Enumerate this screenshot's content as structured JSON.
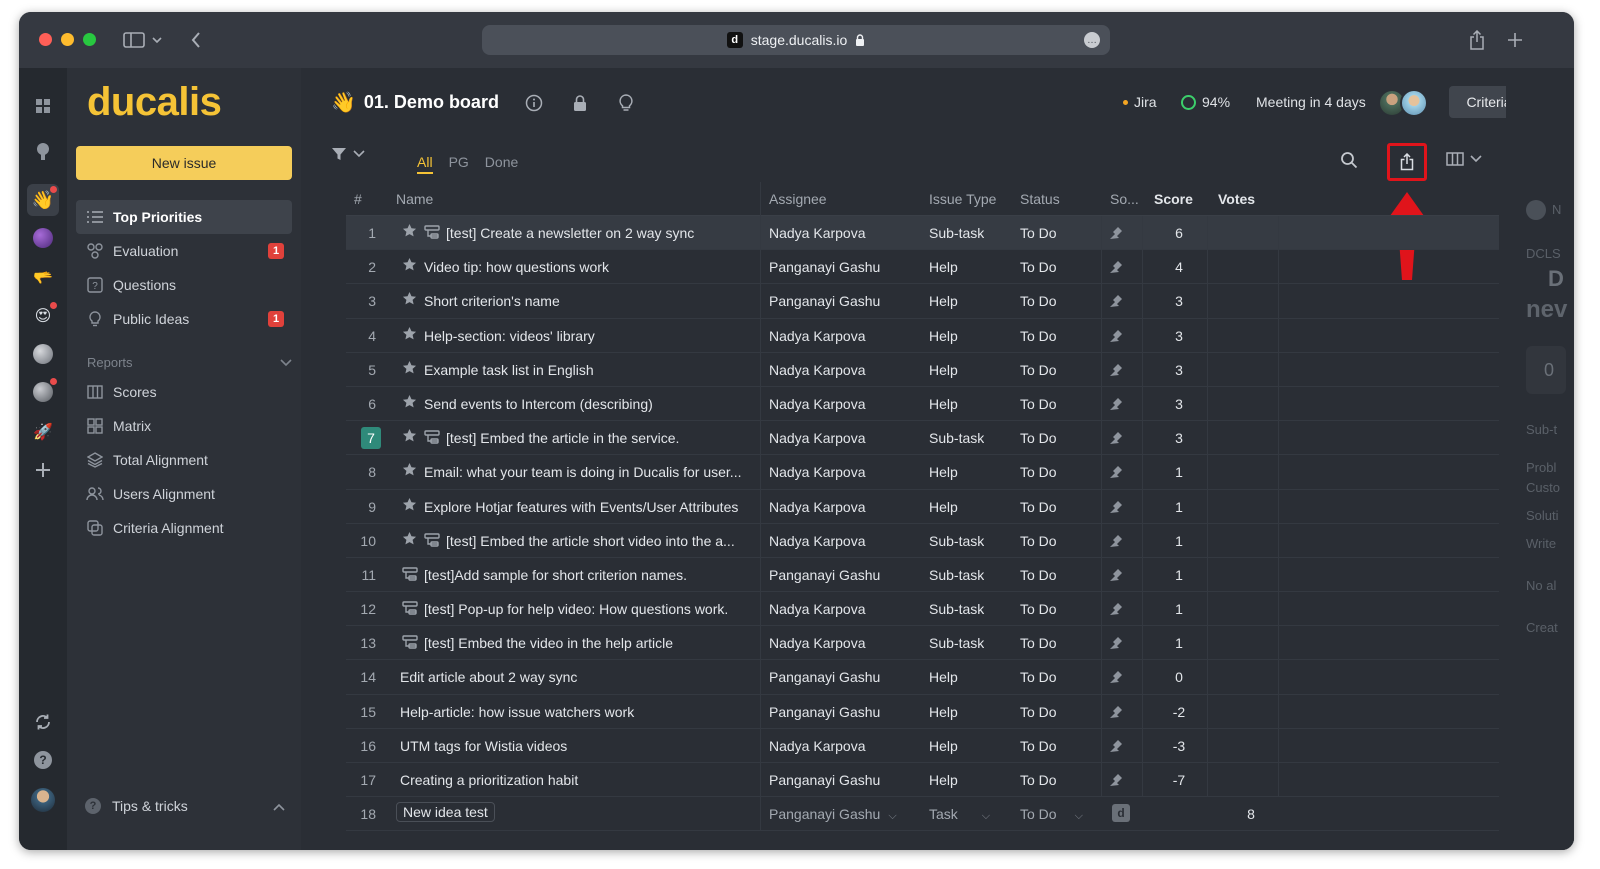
{
  "browser": {
    "url": "stage.ducalis.io",
    "favicon_letter": "d",
    "more_label": "…"
  },
  "sidebar": {
    "logo": "ducalis",
    "new_issue_label": "New issue",
    "items": [
      {
        "label": "Top Priorities",
        "icon": "list-icon",
        "active": true
      },
      {
        "label": "Evaluation",
        "icon": "nodes-icon",
        "badge": "1"
      },
      {
        "label": "Questions",
        "icon": "question-box-icon"
      },
      {
        "label": "Public Ideas",
        "icon": "lightbulb-icon",
        "badge": "1"
      }
    ],
    "reports_label": "Reports",
    "reports": [
      {
        "label": "Scores",
        "icon": "columns-icon"
      },
      {
        "label": "Matrix",
        "icon": "grid-icon"
      },
      {
        "label": "Total Alignment",
        "icon": "layers-icon"
      },
      {
        "label": "Users Alignment",
        "icon": "users-icon"
      },
      {
        "label": "Criteria Alignment",
        "icon": "overlap-icon"
      }
    ],
    "tips_label": "Tips & tricks"
  },
  "header": {
    "emoji": "👋",
    "board_title": "01. Demo board",
    "jira_label": "Jira",
    "progress": "94%",
    "meeting": "Meeting in 4 days",
    "criteria_label": "Criteria"
  },
  "tabs": [
    "All",
    "PG",
    "Done"
  ],
  "table": {
    "columns": {
      "num": "#",
      "name": "Name",
      "assignee": "Assignee",
      "type": "Issue Type",
      "status": "Status",
      "so": "So...",
      "score": "Score",
      "votes": "Votes"
    },
    "rows": [
      {
        "n": "1",
        "star": true,
        "sub": true,
        "name": "[test] Create a newsletter on 2 way sync",
        "assignee": "Nadya Karpova",
        "type": "Sub-task",
        "status": "To Do",
        "score": "6"
      },
      {
        "n": "2",
        "star": true,
        "sub": false,
        "name": "Video tip: how questions work",
        "assignee": "Panganayi Gashu",
        "type": "Help",
        "status": "To Do",
        "score": "4"
      },
      {
        "n": "3",
        "star": true,
        "sub": false,
        "name": "Short criterion's name",
        "assignee": "Panganayi Gashu",
        "type": "Help",
        "status": "To Do",
        "score": "3"
      },
      {
        "n": "4",
        "star": true,
        "sub": false,
        "name": "Help-section: videos' library",
        "assignee": "Nadya Karpova",
        "type": "Help",
        "status": "To Do",
        "score": "3"
      },
      {
        "n": "5",
        "star": true,
        "sub": false,
        "name": "Example task list in English",
        "assignee": "Nadya Karpova",
        "type": "Help",
        "status": "To Do",
        "score": "3"
      },
      {
        "n": "6",
        "star": true,
        "sub": false,
        "name": "Send events to Intercom (describing)",
        "assignee": "Nadya Karpova",
        "type": "Help",
        "status": "To Do",
        "score": "3"
      },
      {
        "n": "7",
        "star": true,
        "sub": true,
        "name": "[test] Embed the article in the service.",
        "assignee": "Nadya Karpova",
        "type": "Sub-task",
        "status": "To Do",
        "score": "3"
      },
      {
        "n": "8",
        "star": true,
        "sub": false,
        "name": "Email: what your team is doing in Ducalis for user...",
        "assignee": "Nadya Karpova",
        "type": "Help",
        "status": "To Do",
        "score": "1"
      },
      {
        "n": "9",
        "star": true,
        "sub": false,
        "name": "Explore Hotjar features with Events/User Attributes",
        "assignee": "Nadya Karpova",
        "type": "Help",
        "status": "To Do",
        "score": "1"
      },
      {
        "n": "10",
        "star": true,
        "sub": true,
        "name": "[test] Embed the article short video into the a...",
        "assignee": "Nadya Karpova",
        "type": "Sub-task",
        "status": "To Do",
        "score": "1"
      },
      {
        "n": "11",
        "star": false,
        "sub": true,
        "name": "[test]Add sample for short criterion names.",
        "assignee": "Panganayi Gashu",
        "type": "Sub-task",
        "status": "To Do",
        "score": "1"
      },
      {
        "n": "12",
        "star": false,
        "sub": true,
        "name": "[test] Pop-up for help video: How questions work.",
        "assignee": "Nadya Karpova",
        "type": "Sub-task",
        "status": "To Do",
        "score": "1"
      },
      {
        "n": "13",
        "star": false,
        "sub": true,
        "name": "[test] Embed the video in the help article",
        "assignee": "Nadya Karpova",
        "type": "Sub-task",
        "status": "To Do",
        "score": "1"
      },
      {
        "n": "14",
        "star": false,
        "sub": false,
        "name": "Edit article about 2 way sync",
        "assignee": "Panganayi Gashu",
        "type": "Help",
        "status": "To Do",
        "score": "0"
      },
      {
        "n": "15",
        "star": false,
        "sub": false,
        "name": "Help-article: how issue watchers work",
        "assignee": "Panganayi Gashu",
        "type": "Help",
        "status": "To Do",
        "score": "-2"
      },
      {
        "n": "16",
        "star": false,
        "sub": false,
        "name": "UTM tags for Wistia videos",
        "assignee": "Nadya Karpova",
        "type": "Help",
        "status": "To Do",
        "score": "-3"
      },
      {
        "n": "17",
        "star": false,
        "sub": false,
        "name": "Creating a prioritization habit",
        "assignee": "Panganayi Gashu",
        "type": "Help",
        "status": "To Do",
        "score": "-7"
      }
    ],
    "new_row": {
      "n": "18",
      "name": "New idea test",
      "assignee": "Panganayi Gashu",
      "type": "Task",
      "status": "To Do",
      "source_badge": "d",
      "votes": "8"
    }
  },
  "peek": [
    "N",
    "DCLS",
    "D",
    "nev",
    "0",
    "Sub-t",
    "Probl",
    "Custo",
    "Soluti",
    "Write",
    "No al",
    "Creat"
  ],
  "colors": {
    "accent": "#f5c336",
    "highlight_box": "#e0141b",
    "badge": "#e0413b",
    "boxed_row": "#2f8a7a"
  }
}
